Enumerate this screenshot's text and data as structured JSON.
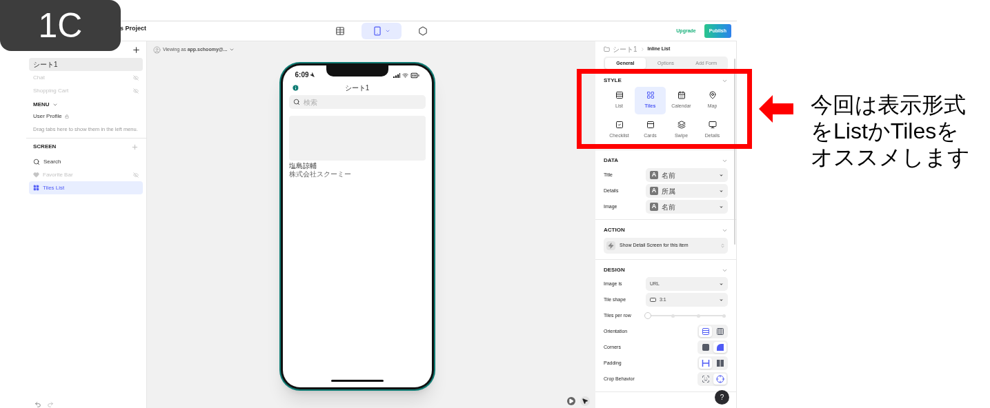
{
  "badge": "1C",
  "project_title": "s Project",
  "sidebar": {
    "tabs": [
      {
        "label": "シート1",
        "selected": true,
        "hidden": false
      },
      {
        "label": "Chat",
        "selected": false,
        "hidden": true
      },
      {
        "label": "Shopping Cart",
        "selected": false,
        "hidden": true
      }
    ],
    "menu": {
      "title": "MENU",
      "items": [
        {
          "label": "User Profile",
          "locked": true
        }
      ],
      "hint": "Drag tabs here to show them in the left menu."
    },
    "screen": {
      "title": "SCREEN",
      "items": [
        {
          "label": "Search",
          "kind": "search",
          "hidden": false,
          "selected": false
        },
        {
          "label": "Favorite Bar",
          "kind": "heart",
          "hidden": true,
          "selected": false
        },
        {
          "label": "Tiles List",
          "kind": "tiles",
          "hidden": false,
          "selected": true
        }
      ]
    }
  },
  "toolbar": {
    "views": [
      {
        "kind": "data",
        "selected": false
      },
      {
        "kind": "layout",
        "selected": true
      },
      {
        "kind": "settings",
        "selected": false
      }
    ],
    "upgrade": "Upgrade",
    "publish": "Publish"
  },
  "canvas": {
    "viewing_as": "Viewing as **app.schoomy@...**"
  },
  "phone": {
    "time": "6:09",
    "title": "シート1",
    "search_placeholder": "検索",
    "tiles": [
      {
        "title": "塩島諒輔",
        "details": "株式会社スクーミー"
      }
    ]
  },
  "panel": {
    "breadcrumb": [
      "シート1",
      "Inline List"
    ],
    "tabs": [
      {
        "label": "General",
        "selected": true
      },
      {
        "label": "Options",
        "selected": false
      },
      {
        "label": "Add Form",
        "selected": false
      }
    ],
    "style": {
      "title": "STYLE",
      "options": [
        {
          "label": "List",
          "kind": "list",
          "selected": false
        },
        {
          "label": "Tiles",
          "kind": "tiles",
          "selected": true
        },
        {
          "label": "Calendar",
          "kind": "calendar",
          "selected": false
        },
        {
          "label": "Map",
          "kind": "map",
          "selected": false
        },
        {
          "label": "Checklist",
          "kind": "checklist",
          "selected": false
        },
        {
          "label": "Cards",
          "kind": "cards",
          "selected": false
        },
        {
          "label": "Swipe",
          "kind": "swipe",
          "selected": false
        },
        {
          "label": "Details",
          "kind": "details",
          "selected": false
        }
      ]
    },
    "data": {
      "title": "DATA",
      "rows": [
        {
          "label": "Title",
          "type": "A",
          "value": "名前"
        },
        {
          "label": "Details",
          "type": "A",
          "value": "所属"
        },
        {
          "label": "Image",
          "type": "A",
          "value": "名前"
        }
      ]
    },
    "action": {
      "title": "ACTION",
      "value": "Show Detail Screen for this item"
    },
    "design": {
      "title": "DESIGN",
      "rows": [
        {
          "kind": "dropdown",
          "label": "Image is",
          "value": "URL",
          "shape_icon": false
        },
        {
          "kind": "dropdown",
          "label": "Tile shape",
          "value": "3:1",
          "shape_icon": true
        },
        {
          "kind": "slider",
          "label": "Tiles per row",
          "level": 0
        },
        {
          "kind": "segmented",
          "label": "Orientation",
          "options": [
            {
              "selected": true
            },
            {
              "selected": false
            }
          ]
        },
        {
          "kind": "segmented",
          "label": "Corners",
          "options": [
            {
              "selected": false
            },
            {
              "selected": true
            }
          ]
        },
        {
          "kind": "segmented",
          "label": "Padding",
          "options": [
            {
              "selected": true
            },
            {
              "selected": false
            }
          ]
        },
        {
          "kind": "segmented",
          "label": "Crop Behavior",
          "options": [
            {
              "selected": false
            },
            {
              "selected": true
            }
          ]
        }
      ]
    },
    "help": "?"
  },
  "annotation": {
    "lines": [
      "今回は表示形式",
      "をListかTilesを",
      "オススメします"
    ]
  }
}
